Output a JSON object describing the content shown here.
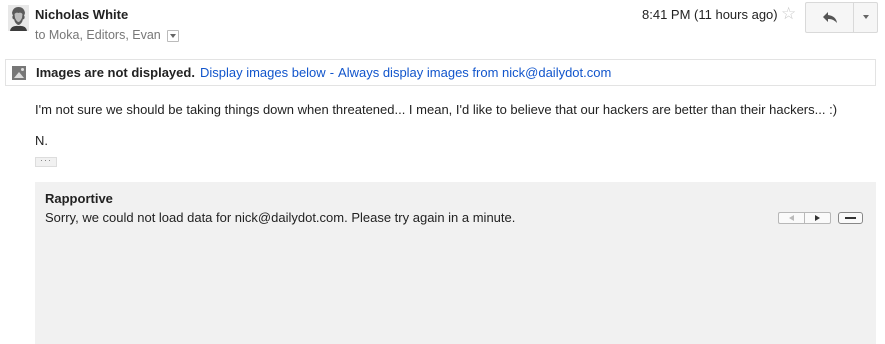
{
  "header": {
    "sender": "Nicholas White",
    "recipients": "to Moka, Editors, Evan",
    "timestamp": "8:41 PM (11 hours ago)"
  },
  "images_notice": {
    "bold_text": "Images are not displayed.",
    "display_below": "Display images below",
    "separator": "-",
    "always_display": "Always display images from nick@dailydot.com"
  },
  "message": {
    "body": "I'm not sure we should be taking things down when threatened... I mean, I'd like to believe that our hackers are better than their hackers... :)",
    "signature": "N."
  },
  "rapportive": {
    "title": "Rapportive",
    "message": "Sorry, we could not load data for nick@dailydot.com. Please try again in a minute."
  },
  "icons": {
    "avatar": "avatar",
    "star": "star-icon",
    "reply": "reply-arrow-icon",
    "more": "chevron-down-icon",
    "image": "image-icon"
  },
  "colors": {
    "link": "#1155cc",
    "panel_bg": "#f1f1f1",
    "muted_text": "#777777"
  }
}
